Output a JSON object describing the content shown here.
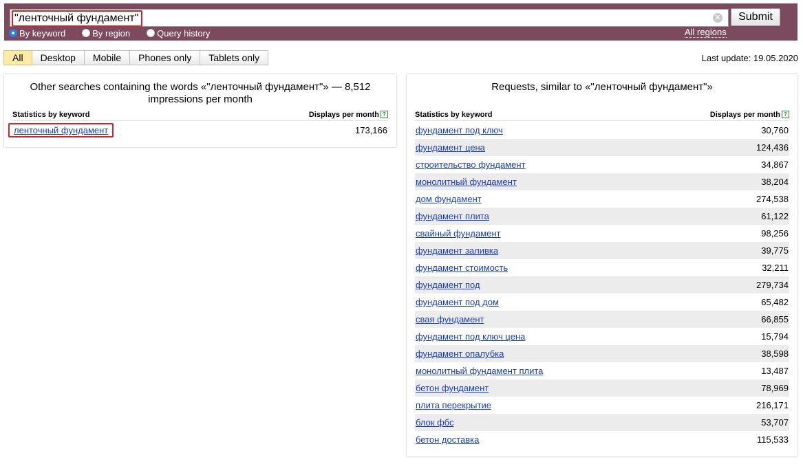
{
  "search": {
    "query": "\"ленточный фундамент\"",
    "submit_label": "Submit",
    "modes": [
      {
        "label": "By keyword",
        "checked": true
      },
      {
        "label": "By region",
        "checked": false
      },
      {
        "label": "Query history",
        "checked": false
      }
    ],
    "all_regions_label": "All regions"
  },
  "tabs": [
    {
      "label": "All",
      "active": true
    },
    {
      "label": "Desktop",
      "active": false
    },
    {
      "label": "Mobile",
      "active": false
    },
    {
      "label": "Phones only",
      "active": false
    },
    {
      "label": "Tablets only",
      "active": false
    }
  ],
  "last_update": "Last update: 19.05.2020",
  "left_panel": {
    "title": "Other searches containing the words «\"ленточный фундамент\"» — 8,512 impressions per month",
    "col_keyword": "Statistics by keyword",
    "col_displays": "Displays per month",
    "rows": [
      {
        "keyword": "ленточный фундамент",
        "count": "173,166"
      }
    ]
  },
  "right_panel": {
    "title": "Requests, similar to «\"ленточный фундамент\"»",
    "col_keyword": "Statistics by keyword",
    "col_displays": "Displays per month",
    "rows": [
      {
        "keyword": "фундамент под ключ",
        "count": "30,760"
      },
      {
        "keyword": "фундамент цена",
        "count": "124,436"
      },
      {
        "keyword": "строительство фундамент",
        "count": "34,867"
      },
      {
        "keyword": "монолитный фундамент",
        "count": "38,204"
      },
      {
        "keyword": "дом фундамент",
        "count": "274,538"
      },
      {
        "keyword": "фундамент плита",
        "count": "61,122"
      },
      {
        "keyword": "свайный фундамент",
        "count": "98,256"
      },
      {
        "keyword": "фундамент заливка",
        "count": "39,775"
      },
      {
        "keyword": "фундамент стоимость",
        "count": "32,211"
      },
      {
        "keyword": "фундамент под",
        "count": "279,734"
      },
      {
        "keyword": "фундамент под дом",
        "count": "65,482"
      },
      {
        "keyword": "свая фундамент",
        "count": "66,855"
      },
      {
        "keyword": "фундамент под ключ цена",
        "count": "15,794"
      },
      {
        "keyword": "фундамент опалубка",
        "count": "38,598"
      },
      {
        "keyword": "монолитный фундамент плита",
        "count": "13,487"
      },
      {
        "keyword": "бетон фундамент",
        "count": "78,969"
      },
      {
        "keyword": "плита перекрытие",
        "count": "216,171"
      },
      {
        "keyword": "блок фбс",
        "count": "53,707"
      },
      {
        "keyword": "бетон доставка",
        "count": "115,533"
      }
    ]
  }
}
